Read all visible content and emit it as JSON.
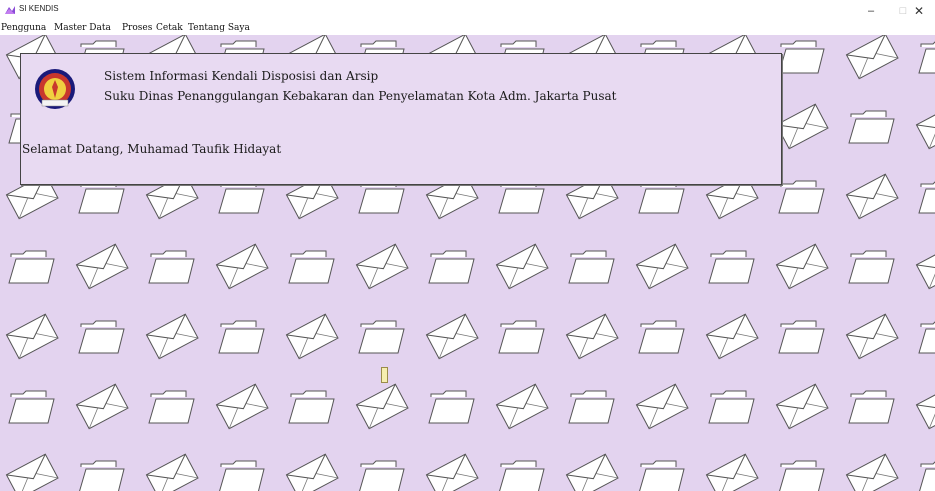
{
  "window": {
    "title": "SI KENDIS",
    "minimize_glyph": "–",
    "maximize_glyph": "□",
    "close_glyph": "✕",
    "icon": "app-logo-icon"
  },
  "menu": {
    "items": [
      {
        "label": "Pengguna"
      },
      {
        "label": "Master Data"
      },
      {
        "label": "Proses"
      },
      {
        "label": "Cetak"
      },
      {
        "label": "Tentang Saya"
      }
    ]
  },
  "header": {
    "system_title": "Sistem Informasi Kendali Disposisi dan Arsip",
    "organization": "Suku Dinas Penanggulangan Kebakaran dan Penyelamatan Kota Adm. Jakarta Pusat",
    "welcome": "Selamat Datang, Muhamad Taufik Hidayat",
    "logo_icon": "fire-department-emblem-icon"
  },
  "background": {
    "pattern_icons": [
      "envelope-icon",
      "folder-icon"
    ],
    "color": "#e3d3ef"
  }
}
